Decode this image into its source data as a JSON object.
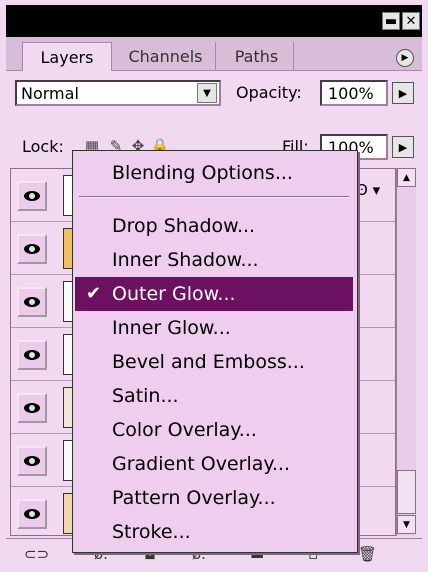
{
  "window": {
    "minimize_icon": "minimize-icon",
    "close_icon": "close-icon"
  },
  "tabs": [
    {
      "label": "Layers",
      "active": true
    },
    {
      "label": "Channels",
      "active": false
    },
    {
      "label": "Paths",
      "active": false
    }
  ],
  "blend_mode": {
    "value": "Normal"
  },
  "opacity": {
    "label": "Opacity:",
    "value": "100%"
  },
  "lock": {
    "label": "Lock:"
  },
  "fill": {
    "label": "Fill:",
    "value": "100%"
  },
  "context_menu": {
    "items": [
      {
        "label": "Blending Options...",
        "checked": false
      },
      {
        "label": "Drop Shadow...",
        "checked": false
      },
      {
        "label": "Inner Shadow...",
        "checked": false
      },
      {
        "label": "Outer Glow...",
        "checked": true
      },
      {
        "label": "Inner Glow...",
        "checked": false
      },
      {
        "label": "Bevel and Emboss...",
        "checked": false
      },
      {
        "label": "Satin...",
        "checked": false
      },
      {
        "label": "Color Overlay...",
        "checked": false
      },
      {
        "label": "Gradient Overlay...",
        "checked": false
      },
      {
        "label": "Pattern Overlay...",
        "checked": false
      },
      {
        "label": "Stroke...",
        "checked": false
      }
    ],
    "check_mark": "✔"
  },
  "colors": {
    "panel_bg": "#f1d9f1",
    "highlight": "#6c1062",
    "thumb_orange": "#f0c060"
  }
}
